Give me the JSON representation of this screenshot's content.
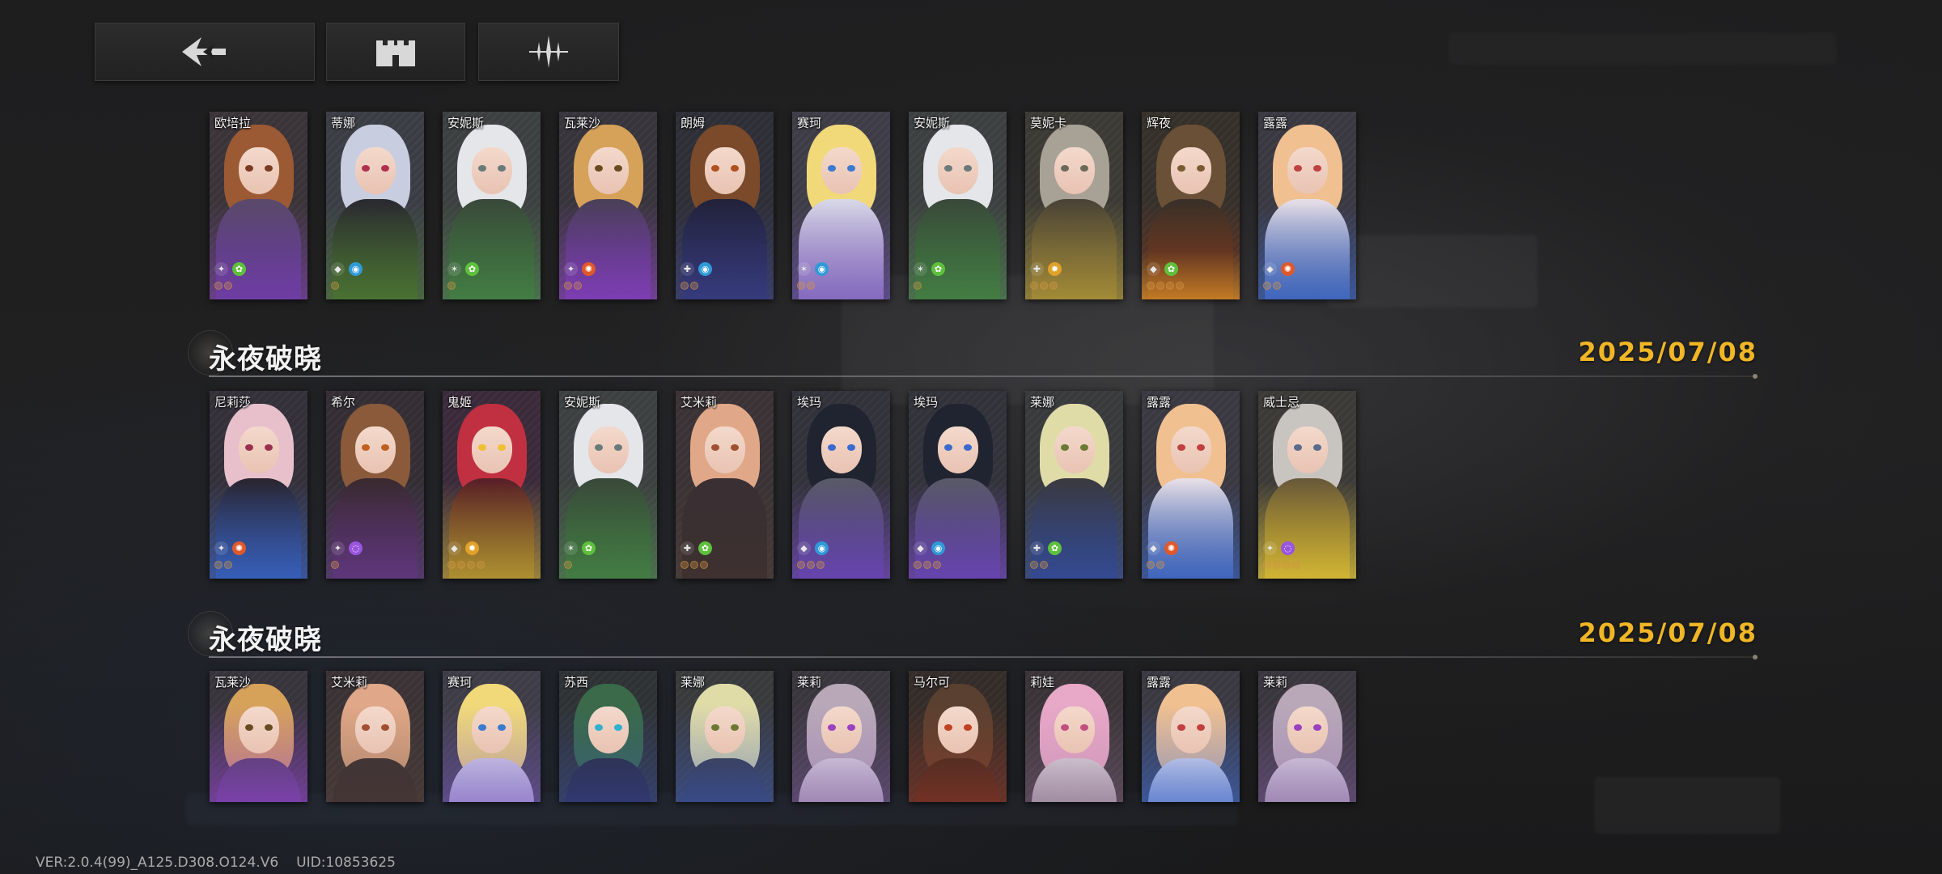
{
  "nav": {
    "buttons": [
      {
        "name": "back-button",
        "icon": "back-arrow-icon"
      },
      {
        "name": "castle-button",
        "icon": "castle-icon"
      },
      {
        "name": "filter-button",
        "icon": "sparkle-icon"
      }
    ]
  },
  "sections": [
    {
      "title": "",
      "date": "",
      "cards": [
        {
          "name": "欧培拉",
          "palette": "orange",
          "cls": "✦",
          "elem": "✿",
          "elem_color": "#5ec03c",
          "stars": 2
        },
        {
          "name": "蒂娜",
          "palette": "silver-green",
          "cls": "◆",
          "elem": "◉",
          "elem_color": "#2f9ad8",
          "stars": 1
        },
        {
          "name": "安妮斯",
          "palette": "white-green",
          "cls": "✶",
          "elem": "✿",
          "elem_color": "#5ec03c",
          "stars": 1
        },
        {
          "name": "瓦莱沙",
          "palette": "blonde-purple",
          "cls": "✦",
          "elem": "✺",
          "elem_color": "#e0582a",
          "stars": 2
        },
        {
          "name": "朗姆",
          "palette": "brown-navy",
          "cls": "✚",
          "elem": "◉",
          "elem_color": "#2f9ad8",
          "stars": 2
        },
        {
          "name": "赛珂",
          "palette": "blonde-white",
          "cls": "✶",
          "elem": "◉",
          "elem_color": "#2f9ad8",
          "stars": 2
        },
        {
          "name": "安妮斯",
          "palette": "white-green",
          "cls": "✶",
          "elem": "✿",
          "elem_color": "#5ec03c",
          "stars": 1
        },
        {
          "name": "莫妮卡",
          "palette": "grey-gold",
          "cls": "✚",
          "elem": "✹",
          "elem_color": "#e0a12a",
          "stars": 3
        },
        {
          "name": "辉夜",
          "palette": "brown-flame",
          "cls": "◆",
          "elem": "✿",
          "elem_color": "#5ec03c",
          "stars": 4
        },
        {
          "name": "露露",
          "palette": "pink-blue",
          "cls": "◆",
          "elem": "✺",
          "elem_color": "#e0582a",
          "stars": 2
        }
      ]
    },
    {
      "title": "永夜破晓",
      "date": "2025/07/08",
      "cards": [
        {
          "name": "尼莉莎",
          "palette": "pink-blue-dark",
          "cls": "✦",
          "elem": "✺",
          "elem_color": "#e0582a",
          "stars": 2
        },
        {
          "name": "希尔",
          "palette": "brown-purple",
          "cls": "✦",
          "elem": "◌",
          "elem_color": "#9a55e0",
          "stars": 1
        },
        {
          "name": "鬼姬",
          "palette": "red-gold",
          "cls": "◆",
          "elem": "✹",
          "elem_color": "#e0a12a",
          "stars": 4
        },
        {
          "name": "安妮斯",
          "palette": "white-green",
          "cls": "✶",
          "elem": "✿",
          "elem_color": "#5ec03c",
          "stars": 1
        },
        {
          "name": "艾米莉",
          "palette": "peach-dark",
          "cls": "✚",
          "elem": "✿",
          "elem_color": "#5ec03c",
          "stars": 3
        },
        {
          "name": "埃玛",
          "palette": "black-purple",
          "cls": "◆",
          "elem": "◉",
          "elem_color": "#2f9ad8",
          "stars": 3
        },
        {
          "name": "埃玛",
          "palette": "black-purple",
          "cls": "◆",
          "elem": "◉",
          "elem_color": "#2f9ad8",
          "stars": 3
        },
        {
          "name": "莱娜",
          "palette": "blonde-blue",
          "cls": "✚",
          "elem": "✿",
          "elem_color": "#5ec03c",
          "stars": 2
        },
        {
          "name": "露露",
          "palette": "pink-blue",
          "cls": "◆",
          "elem": "✺",
          "elem_color": "#e0582a",
          "stars": 2
        },
        {
          "name": "威士忌",
          "palette": "silver-gold",
          "cls": "✦",
          "elem": "◌",
          "elem_color": "#9a55e0",
          "stars": 4
        }
      ]
    },
    {
      "title": "永夜破晓",
      "date": "2025/07/08",
      "cards": [
        {
          "name": "瓦莱沙",
          "palette": "blonde-purple",
          "cls": "",
          "elem": "",
          "elem_color": "#e0582a",
          "stars": 0
        },
        {
          "name": "艾米莉",
          "palette": "peach-dark",
          "cls": "",
          "elem": "",
          "elem_color": "#5ec03c",
          "stars": 0
        },
        {
          "name": "赛珂",
          "palette": "blonde-white",
          "cls": "",
          "elem": "",
          "elem_color": "#2f9ad8",
          "stars": 0
        },
        {
          "name": "苏西",
          "palette": "green-navy",
          "cls": "",
          "elem": "",
          "elem_color": "#2f9ad8",
          "stars": 0
        },
        {
          "name": "莱娜",
          "palette": "blonde-blue",
          "cls": "",
          "elem": "",
          "elem_color": "#5ec03c",
          "stars": 0
        },
        {
          "name": "莱莉",
          "palette": "lavender",
          "cls": "",
          "elem": "",
          "elem_color": "#9a55e0",
          "stars": 0
        },
        {
          "name": "马尔可",
          "palette": "brown-red",
          "cls": "",
          "elem": "",
          "elem_color": "#e0582a",
          "stars": 0
        },
        {
          "name": "莉娃",
          "palette": "pink-grey",
          "cls": "",
          "elem": "",
          "elem_color": "#9a55e0",
          "stars": 0
        },
        {
          "name": "露露",
          "palette": "pink-blue",
          "cls": "",
          "elem": "",
          "elem_color": "#e0582a",
          "stars": 0
        },
        {
          "name": "莱莉",
          "palette": "lavender",
          "cls": "",
          "elem": "",
          "elem_color": "#9a55e0",
          "stars": 0
        }
      ]
    }
  ],
  "footer": {
    "version": "VER:2.0.4(99)_A125.D308.O124.V6",
    "uid": "UID:10853625"
  },
  "colors": {
    "accent_date": "#f0b625",
    "background": "#1b1b1c"
  }
}
